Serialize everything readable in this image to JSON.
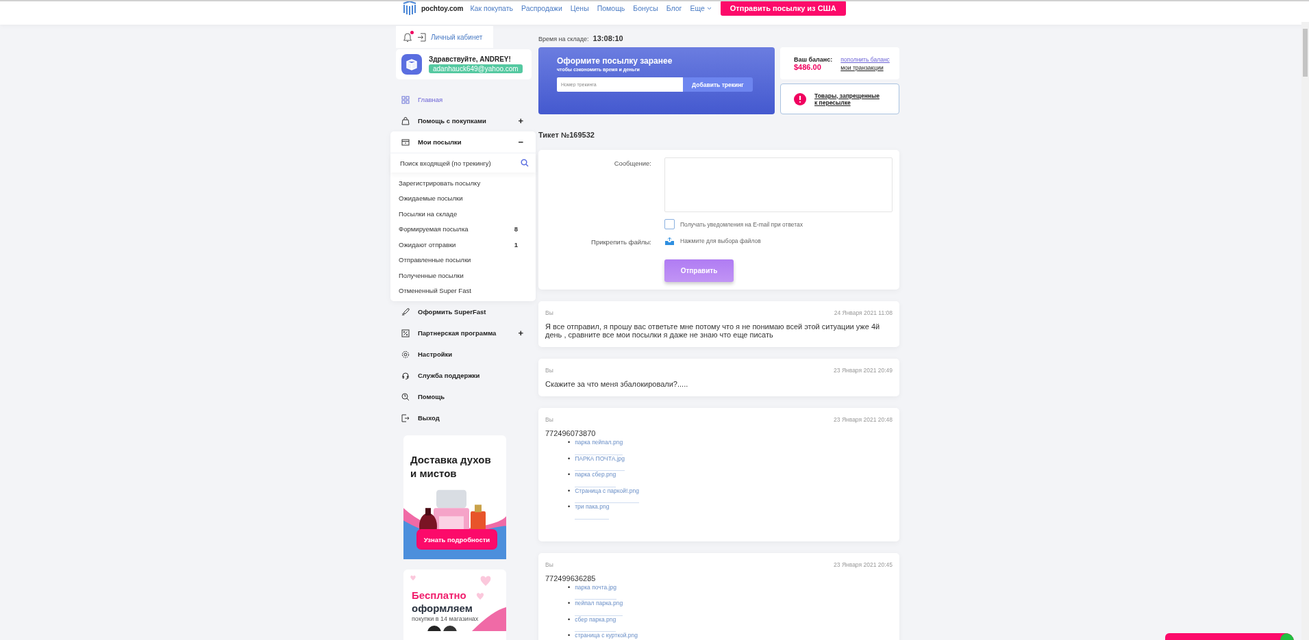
{
  "header": {
    "logo": "pochtoy.com",
    "nav": [
      {
        "label": "Как покупать",
        "dropdown": false
      },
      {
        "label": "Распродажи",
        "dropdown": false
      },
      {
        "label": "Цены",
        "dropdown": false
      },
      {
        "label": "Помощь",
        "dropdown": false
      },
      {
        "label": "Бонусы",
        "dropdown": false
      },
      {
        "label": "Блог",
        "dropdown": false
      },
      {
        "label": "Еще",
        "dropdown": true
      }
    ],
    "cta": "Отправить посылку из США"
  },
  "account": {
    "notification_unread": true,
    "cabinet_link": "Личный кабинет",
    "greeting": "Здравствуйте, ANDREY!",
    "email": "adanhauck649@yahoo.com"
  },
  "sidebar": {
    "items": [
      {
        "label": "Главная",
        "selected": true
      },
      {
        "label": "Помощь с покупками",
        "selected": false,
        "toggle": "+"
      },
      {
        "label": "Мои посылки",
        "selected": false,
        "toggle": "−",
        "expanded": true,
        "search_placeholder": "Поиск входящей (по трекингу)",
        "children": [
          {
            "label": "Зарегистрировать посылку"
          },
          {
            "label": "Ожидаемые посылки"
          },
          {
            "label": "Посылки на складе"
          },
          {
            "label": "Формируемая посылка",
            "count": "8"
          },
          {
            "label": "Ожидают отправки",
            "count": "1"
          },
          {
            "label": "Отправленные посылки"
          },
          {
            "label": "Полученные посылки"
          },
          {
            "label": "Отмененный Super Fast"
          }
        ]
      },
      {
        "label": "Оформить SuperFast",
        "selected": false
      },
      {
        "label": "Партнерская программа",
        "selected": false,
        "toggle": "+"
      },
      {
        "label": "Настройки",
        "selected": false
      },
      {
        "label": "Служба поддержки",
        "selected": false
      },
      {
        "label": "Помощь",
        "selected": false
      },
      {
        "label": "Выход",
        "selected": false
      }
    ]
  },
  "promos": [
    {
      "kind": "perfume",
      "title": "Доставка духов и мистов",
      "button": "Узнать подробности"
    },
    {
      "kind": "shops",
      "title_accent": "Бесплатно",
      "title": "оформляем",
      "subtitle": "покупки в 14 магазинах"
    }
  ],
  "warehouse_time": {
    "label": "Время на складе:",
    "value": "13:08:10"
  },
  "tracking_banner": {
    "title": "Оформите посылку заранее",
    "subtitle": "чтобы сэкономить время и деньги",
    "placeholder": "Номер трекинга",
    "button": "Добавить трекинг"
  },
  "balance": {
    "label": "Ваш баланс:",
    "amount": "$486.00",
    "topup_link": "пополнить баланс",
    "transactions_link": "мои транзакции"
  },
  "prohibited": {
    "link": "Товары, запрещенные к пересылке"
  },
  "ticket": {
    "title": "Тикет №169532",
    "message_label": "Сообщение:",
    "notify_label": "Получать уведомления на E-mail при ответах",
    "notify_checked": false,
    "attach_label": "Прикрепить файлы:",
    "attach_hint": "Нажмите для выбора файлов",
    "send": "Отправить"
  },
  "messages": [
    {
      "author": "Вы",
      "date": "24 Января 2021 11:08",
      "text": "Я все отправил, я прошу вас ответьте мне потому что я не понимаю всей этой ситуации уже 4й день , сравните все мои посылки я даже не знаю что еще писать"
    },
    {
      "author": "Вы",
      "date": "23 Января 2021 20:49",
      "text": "Скажите за что меня збалокировали?....."
    },
    {
      "author": "Вы",
      "date": "23 Января 2021 20:48",
      "text": "772496073870",
      "bullet": "•",
      "files": [
        "парка пейпал.png",
        "ПАРКА ПОЧТА.jpg",
        "парка сбер.png",
        "Страница с паркой!.png",
        "три пака.png"
      ]
    },
    {
      "author": "Вы",
      "date": "23 Января 2021 20:45",
      "text": "772499636285",
      "bullet": "•",
      "files": [
        "парка почта.jpg",
        "пейпал парка.png",
        "сбер парка.png",
        "страница с курткой.png"
      ]
    }
  ]
}
